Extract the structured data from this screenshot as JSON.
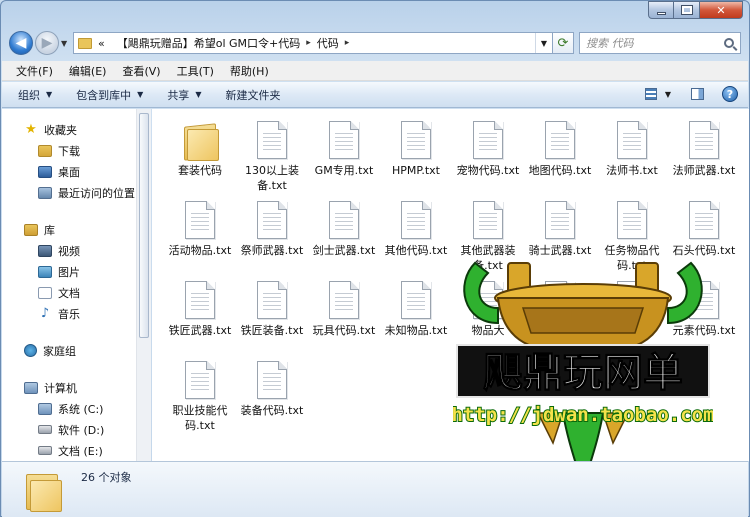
{
  "address": {
    "prefix": "«",
    "path": [
      "【飓鼎玩赠品】希望ol GM口令+代码",
      "代码"
    ]
  },
  "search": {
    "placeholder": "搜索 代码"
  },
  "menu": [
    "文件(F)",
    "编辑(E)",
    "查看(V)",
    "工具(T)",
    "帮助(H)"
  ],
  "toolbar": {
    "organize": "组织",
    "include_library": "包含到库中",
    "share": "共享",
    "new_folder": "新建文件夹"
  },
  "sidebar": {
    "favorites": {
      "label": "收藏夹",
      "items": [
        "下载",
        "桌面",
        "最近访问的位置"
      ]
    },
    "libraries": {
      "label": "库",
      "items": [
        "视频",
        "图片",
        "文档",
        "音乐"
      ]
    },
    "homegroup": "家庭组",
    "computer": {
      "label": "计算机",
      "items": [
        "系统 (C:)",
        "软件 (D:)",
        "文档 (E:)"
      ]
    }
  },
  "files": [
    {
      "name": "套装代码",
      "type": "folder"
    },
    {
      "name": "130以上装备.txt",
      "type": "txt"
    },
    {
      "name": "GM专用.txt",
      "type": "txt"
    },
    {
      "name": "HPMP.txt",
      "type": "txt"
    },
    {
      "name": "宠物代码.txt",
      "type": "txt"
    },
    {
      "name": "地图代码.txt",
      "type": "txt"
    },
    {
      "name": "法师书.txt",
      "type": "txt"
    },
    {
      "name": "法师武器.txt",
      "type": "txt"
    },
    {
      "name": "活动物品.txt",
      "type": "txt"
    },
    {
      "name": "祭师武器.txt",
      "type": "txt"
    },
    {
      "name": "剑士武器.txt",
      "type": "txt"
    },
    {
      "name": "其他代码.txt",
      "type": "txt"
    },
    {
      "name": "其他武器装备.txt",
      "type": "txt"
    },
    {
      "name": "骑士武器.txt",
      "type": "txt"
    },
    {
      "name": "任务物品代码.txt",
      "type": "txt"
    },
    {
      "name": "石头代码.txt",
      "type": "txt"
    },
    {
      "name": "铁匠武器.txt",
      "type": "txt"
    },
    {
      "name": "铁匠装备.txt",
      "type": "txt"
    },
    {
      "name": "玩具代码.txt",
      "type": "txt"
    },
    {
      "name": "未知物品.txt",
      "type": "txt"
    },
    {
      "name": "物品大",
      "type": "txt"
    },
    {
      "name": "",
      "type": "txt"
    },
    {
      "name": "",
      "type": "txt"
    },
    {
      "name": "元素代码.txt",
      "type": "txt"
    },
    {
      "name": "职业技能代码.txt",
      "type": "txt"
    },
    {
      "name": "装备代码.txt",
      "type": "txt"
    }
  ],
  "watermark": {
    "brand": "飓鼎玩网单",
    "url": "http://jdwan.taobao.com"
  },
  "status": {
    "count": "26 个对象"
  },
  "colors": {
    "accent": "#2f7bd1",
    "watermark_green": "#2fb12f",
    "watermark_gold": "#d9a62a"
  }
}
